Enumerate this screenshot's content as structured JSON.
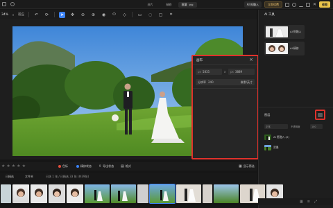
{
  "titlebar": {
    "tabs": [
      {
        "label": "选片"
      },
      {
        "label": "精修"
      },
      {
        "label": "批量",
        "badge": "999",
        "active": true
      }
    ],
    "ai_button": "AI 抠融入",
    "vip_button": "立即续费",
    "upgrade_button": "修图"
  },
  "toolbar": {
    "zoom": "34%",
    "fit": "适应",
    "tools": [
      "select-icon",
      "move-icon",
      "heal-icon",
      "clone-icon",
      "eye-icon",
      "brush-icon",
      "eraser-icon",
      "marquee-icon",
      "lasso-icon",
      "crop-icon"
    ]
  },
  "dialog": {
    "title": "画布",
    "width_value": "5835",
    "height_value": "3889",
    "link_label": "x",
    "unit_w": "px",
    "unit_h": "px",
    "resolution_label": "分辨率",
    "resolution_value": "240",
    "anchor_label": "像素/英寸"
  },
  "panel": {
    "title": "AI 工具",
    "cards": [
      {
        "label": "AI 抠融入"
      },
      {
        "label": "AI 精修"
      }
    ],
    "layers_title": "图层",
    "layer_opts": [
      "正常",
      "不透明度",
      "100"
    ],
    "layers": [
      {
        "label": "AI 抠融入 (2)"
      },
      {
        "label": "背景"
      }
    ]
  },
  "actionbar": {
    "stars_count": 5,
    "actions": [
      {
        "label": "色标",
        "color": "#e04d3c"
      },
      {
        "label": "精修状态",
        "color": "#3b82f6"
      },
      {
        "label": "导出状态",
        "color": "#bdbdbd"
      },
      {
        "label": "格式",
        "color": "#bdbdbd"
      }
    ],
    "right_action": "显示筛选"
  },
  "filterbar": {
    "tab_all": "已精选",
    "tab_files": "文件夹",
    "summary": "已选 1 张 / 已精选 33 张 (共39张)"
  },
  "colors": {
    "accent": "#3b82f6",
    "highlight_border": "#e0322c",
    "gold": "#f0c572"
  }
}
